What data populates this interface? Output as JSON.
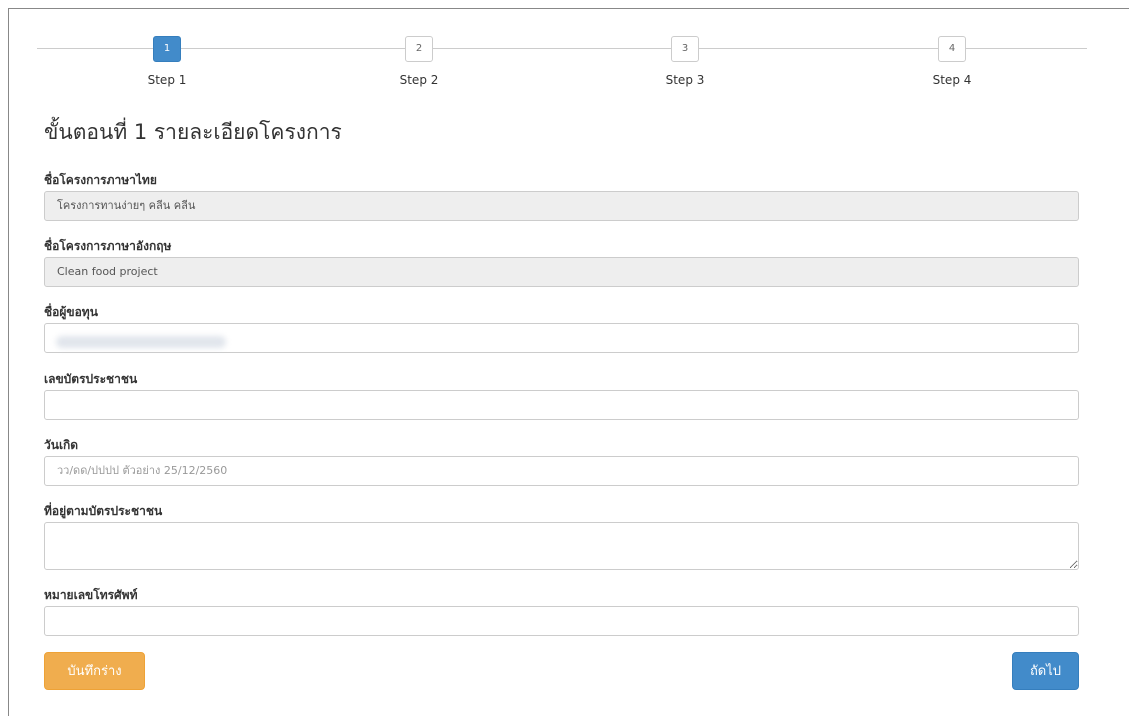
{
  "stepper": {
    "steps": [
      {
        "number": "1",
        "label": "Step 1"
      },
      {
        "number": "2",
        "label": "Step 2"
      },
      {
        "number": "3",
        "label": "Step 3"
      },
      {
        "number": "4",
        "label": "Step 4"
      }
    ],
    "active_step": 1
  },
  "form": {
    "title": "ขั้นตอนที่ 1 รายละเอียดโครงการ",
    "project_name_th": {
      "label": "ชื่อโครงการภาษาไทย",
      "value": "โครงการทานง่ายๆ คลีน คลีน"
    },
    "project_name_en": {
      "label": "ชื่อโครงการภาษาอังกฤษ",
      "value": "Clean food project"
    },
    "applicant_name": {
      "label": "ชื่อผู้ขอทุน",
      "value": ""
    },
    "id_card": {
      "label": "เลขบัตรประชาชน",
      "value": ""
    },
    "birth_date": {
      "label": "วันเกิด",
      "placeholder": "วว/ดด/ปปปป ตัวอย่าง 25/12/2560"
    },
    "address": {
      "label": "ที่อยู่ตามบัตรประชาชน",
      "value": ""
    },
    "phone": {
      "label": "หมายเลขโทรศัพท์",
      "value": ""
    }
  },
  "buttons": {
    "save_draft": "บันทึกร่าง",
    "next": "ถัดไป"
  },
  "colors": {
    "primary": "#428bca",
    "warning": "#f0ad4e"
  }
}
